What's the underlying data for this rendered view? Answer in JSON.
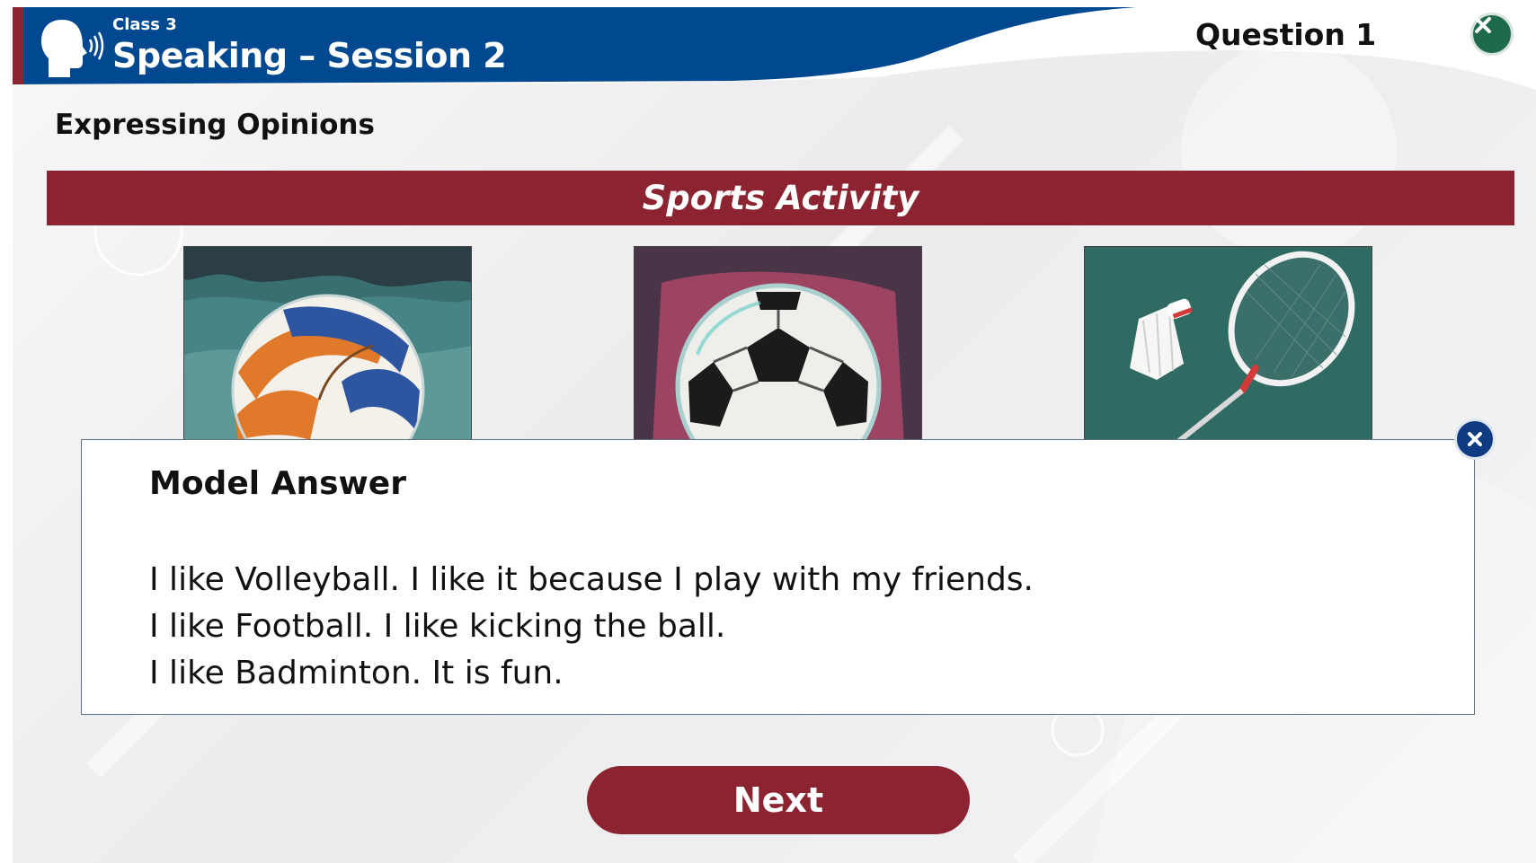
{
  "header": {
    "class_label": "Class 3",
    "session_title": "Speaking – Session 2",
    "question_label": "Question 1",
    "close_icon": "close-icon"
  },
  "lesson": {
    "subtitle": "Expressing Opinions",
    "banner_title": "Sports Activity"
  },
  "tiles": [
    {
      "name": "volleyball",
      "icon": "volleyball-image"
    },
    {
      "name": "football",
      "icon": "football-image"
    },
    {
      "name": "badminton",
      "icon": "badminton-image"
    }
  ],
  "modal": {
    "title": "Model Answer",
    "lines": [
      "I like Volleyball. I like it because I play with my friends.",
      "I like Football. I like kicking the ball.",
      "I like Badminton. It is fun."
    ],
    "close_icon": "close-icon"
  },
  "footer": {
    "next_label": "Next"
  },
  "colors": {
    "header_blue": "#004990",
    "maroon": "#8b2430",
    "close_green": "#1e6a4c",
    "modal_close_blue": "#0f3b83"
  }
}
